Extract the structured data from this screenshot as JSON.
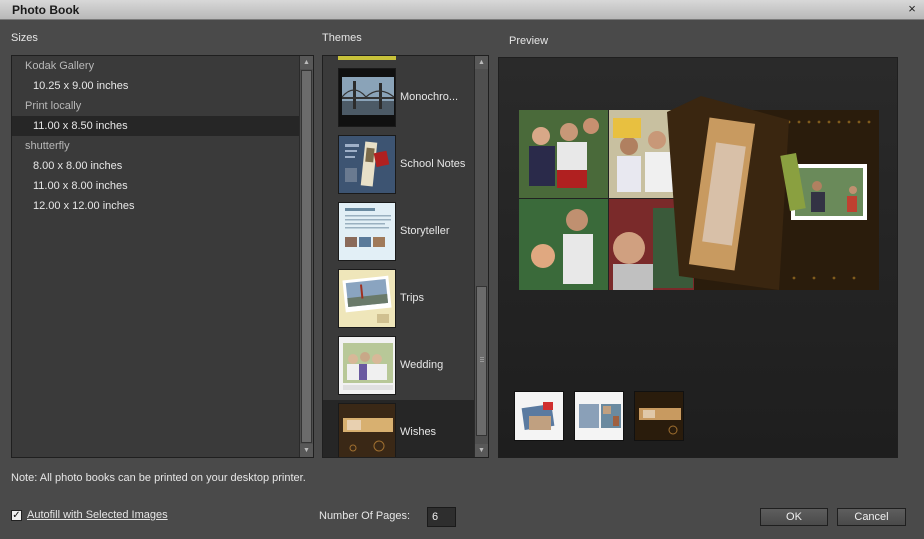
{
  "window": {
    "title": "Photo Book",
    "close_glyph": "×"
  },
  "sizes": {
    "label": "Sizes",
    "groups": [
      {
        "name": "Kodak Gallery",
        "items": [
          "10.25 x 9.00 inches"
        ]
      },
      {
        "name": "Print locally",
        "items": [
          "11.00 x 8.50 inches"
        ]
      },
      {
        "name": "shutterfly",
        "items": [
          "8.00 x 8.00 inches",
          "11.00 x 8.00 inches",
          "12.00 x 12.00 inches"
        ]
      }
    ],
    "selected": "11.00 x 8.50 inches"
  },
  "themes": {
    "label": "Themes",
    "items": [
      "Monochro...",
      "School Notes",
      "Storyteller",
      "Trips",
      "Wedding",
      "Wishes"
    ],
    "selected": "Wishes"
  },
  "preview": {
    "label": "Preview"
  },
  "note": "Note: All photo books can be printed on your desktop printer.",
  "autofill": {
    "label": "Autofill with Selected Images",
    "checked": true,
    "check_glyph": "✓"
  },
  "pages": {
    "label": "Number Of Pages:",
    "value": "6"
  },
  "buttons": {
    "ok": "OK",
    "cancel": "Cancel"
  },
  "colors": {
    "panel_bg": "#3a3a3a",
    "window_bg": "#4a4a4a",
    "selected_row": "#262626"
  }
}
